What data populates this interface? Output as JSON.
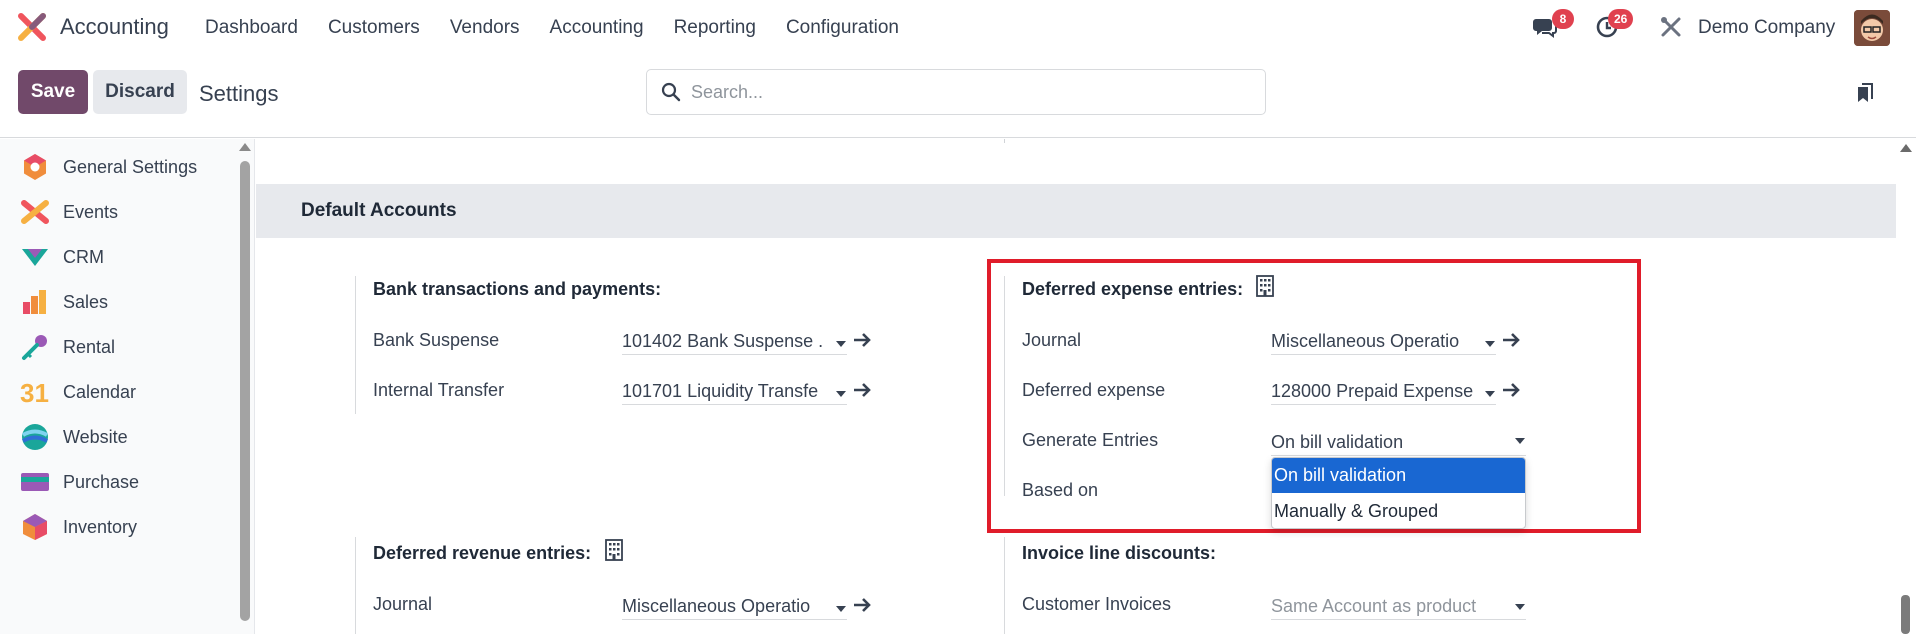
{
  "navbar": {
    "app_name": "Accounting",
    "menu": [
      "Dashboard",
      "Customers",
      "Vendors",
      "Accounting",
      "Reporting",
      "Configuration"
    ],
    "messages_count": "8",
    "activities_count": "26",
    "company": "Demo Company",
    "icons": [
      "discuss-icon",
      "activity-clock-icon",
      "debug-tools-icon"
    ]
  },
  "controlpanel": {
    "save_label": "Save",
    "discard_label": "Discard",
    "breadcrumb": "Settings",
    "search_placeholder": "Search..."
  },
  "sidebar": {
    "items": [
      {
        "label": "General Settings",
        "icon": "general-settings-icon"
      },
      {
        "label": "Events",
        "icon": "events-icon"
      },
      {
        "label": "CRM",
        "icon": "crm-icon"
      },
      {
        "label": "Sales",
        "icon": "sales-icon"
      },
      {
        "label": "Rental",
        "icon": "rental-icon"
      },
      {
        "label": "Calendar",
        "icon": "calendar-icon"
      },
      {
        "label": "Website",
        "icon": "website-icon"
      },
      {
        "label": "Purchase",
        "icon": "purchase-icon"
      },
      {
        "label": "Inventory",
        "icon": "inventory-icon"
      }
    ]
  },
  "main": {
    "section_title": "Default Accounts",
    "bank": {
      "title": "Bank transactions and payments:",
      "rows": [
        {
          "label": "Bank Suspense",
          "value": "101402 Bank Suspense ."
        },
        {
          "label": "Internal Transfer",
          "value": "101701 Liquidity Transfe"
        }
      ]
    },
    "deferred_expense": {
      "title": "Deferred expense entries:",
      "rows": [
        {
          "label": "Journal",
          "value": "Miscellaneous Operatio"
        },
        {
          "label": "Deferred expense",
          "value": "128000 Prepaid Expense"
        },
        {
          "label": "Generate Entries",
          "value": "On bill validation"
        },
        {
          "label": "Based on",
          "value": ""
        }
      ],
      "dropdown_options": [
        "On bill validation",
        "Manually & Grouped"
      ],
      "dropdown_selected": "On bill validation"
    },
    "deferred_revenue": {
      "title": "Deferred revenue entries:",
      "rows": [
        {
          "label": "Journal",
          "value": "Miscellaneous Operatio"
        }
      ]
    },
    "invoice_discounts": {
      "title": "Invoice line discounts:",
      "rows": [
        {
          "label": "Customer Invoices",
          "placeholder": "Same Account as product"
        }
      ]
    }
  },
  "colors": {
    "primary": "#71496a",
    "badge": "#e0414f",
    "highlight": "#e01c2a",
    "selection": "#1967d2"
  }
}
